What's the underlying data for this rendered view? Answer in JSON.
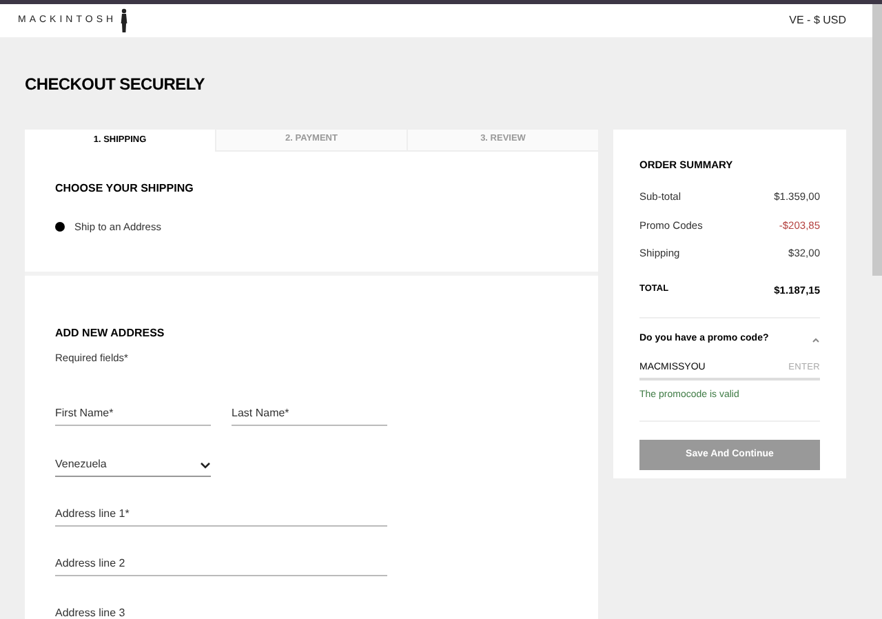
{
  "header": {
    "logo": "MACKINTOSH",
    "locale": "VE - $ USD"
  },
  "page_title": "CHECKOUT SECURELY",
  "tabs": [
    {
      "label": "1. SHIPPING",
      "selected": true
    },
    {
      "label": "2. PAYMENT",
      "selected": false
    },
    {
      "label": "3. REVIEW",
      "selected": false
    }
  ],
  "shipping": {
    "heading": "CHOOSE YOUR SHIPPING",
    "options": [
      {
        "label": "Ship to an Address",
        "selected": true
      }
    ]
  },
  "address": {
    "heading": "ADD NEW ADDRESS",
    "note": "Required fields*",
    "fields": [
      {
        "kind": "short",
        "placeholder": "First Name*"
      },
      {
        "kind": "short",
        "placeholder": "Last Name*"
      },
      {
        "kind": "select",
        "value": "Venezuela"
      },
      {
        "kind": "long",
        "placeholder": "Address line 1*"
      },
      {
        "kind": "long",
        "placeholder": "Address line 2"
      },
      {
        "kind": "long",
        "placeholder": "Address line 3"
      }
    ]
  },
  "summary": {
    "title": "ORDER SUMMARY",
    "lines": [
      {
        "label": "Sub-total",
        "value": "$1.359,00",
        "kind": "normal"
      },
      {
        "label": "Promo Codes",
        "value": "-$203,85",
        "kind": "discount"
      },
      {
        "label": "Shipping",
        "value": "$32,00",
        "kind": "normal"
      }
    ],
    "total": {
      "label": "TOTAL",
      "value": "$1.187,15"
    },
    "promo": {
      "question": "Do you have a promo code?",
      "expanded": true,
      "code": "MACMISSYOU",
      "enter": "ENTER",
      "message": "The promocode is valid"
    },
    "button": {
      "label": "Save And Continue",
      "disabled": true
    }
  }
}
